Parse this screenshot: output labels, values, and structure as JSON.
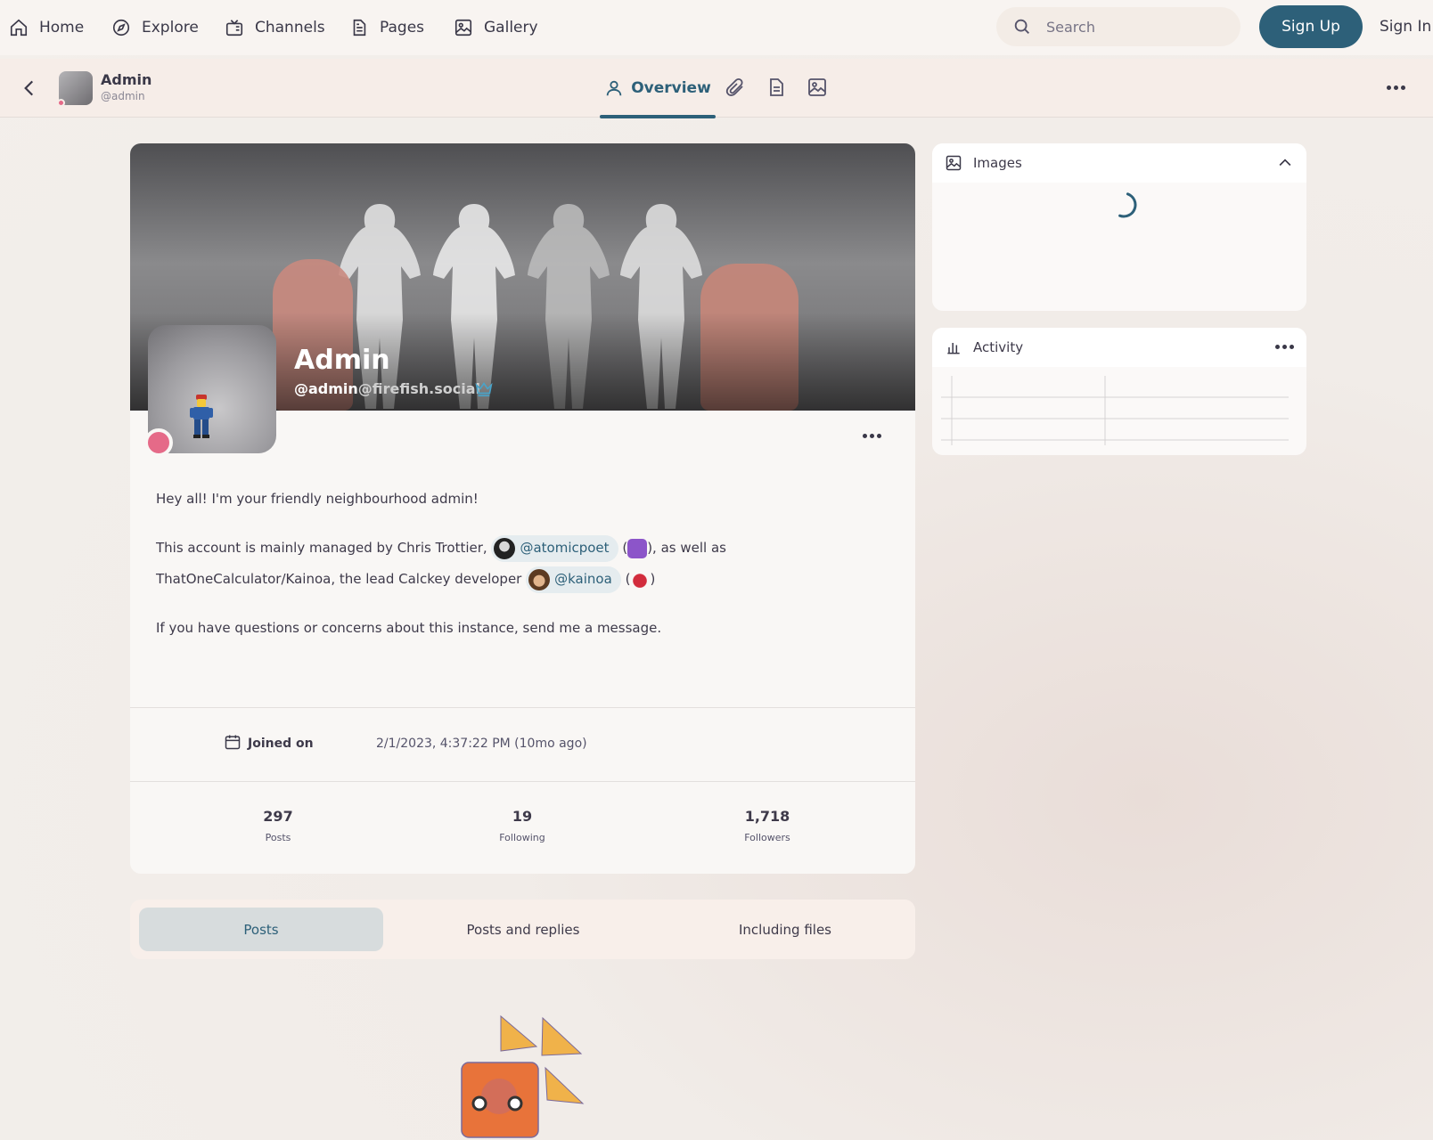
{
  "topnav": {
    "items": [
      {
        "label": "Home",
        "icon": "home-icon"
      },
      {
        "label": "Explore",
        "icon": "compass-icon"
      },
      {
        "label": "Channels",
        "icon": "channels-icon"
      },
      {
        "label": "Pages",
        "icon": "page-icon"
      },
      {
        "label": "Gallery",
        "icon": "image-icon"
      }
    ],
    "search_placeholder": "Search",
    "signup_label": "Sign Up",
    "signin_label": "Sign In"
  },
  "subheader": {
    "name": "Admin",
    "handle": "@admin",
    "tab_overview": "Overview"
  },
  "profile": {
    "name": "Admin",
    "acct_user": "@admin",
    "acct_host": "@firefish.social",
    "bio": {
      "line1": "Hey all! I'm your friendly neighbourhood admin!",
      "line2_a": "This account is mainly managed by Chris Trottier,",
      "mention1": "@atomicpoet",
      "line2_b": "), as well as ThatOneCalculator/Kainoa, the lead Calckey developer",
      "mention2": "@kainoa",
      "paren_open": "(",
      "paren_close": ")",
      "line3": "If you have questions or concerns about this instance, send me a message."
    },
    "joined_label": "Joined on",
    "joined_value": "2/1/2023, 4:37:22 PM (10mo ago)",
    "stats": [
      {
        "num": "297",
        "label": "Posts"
      },
      {
        "num": "19",
        "label": "Following"
      },
      {
        "num": "1,718",
        "label": "Followers"
      }
    ]
  },
  "post_tabs": [
    "Posts",
    "Posts and replies",
    "Including files"
  ],
  "widgets": {
    "images_title": "Images",
    "activity_title": "Activity"
  },
  "colors": {
    "accent": "#2d6079",
    "online": "#e56a88",
    "background": "#f3efeb"
  }
}
